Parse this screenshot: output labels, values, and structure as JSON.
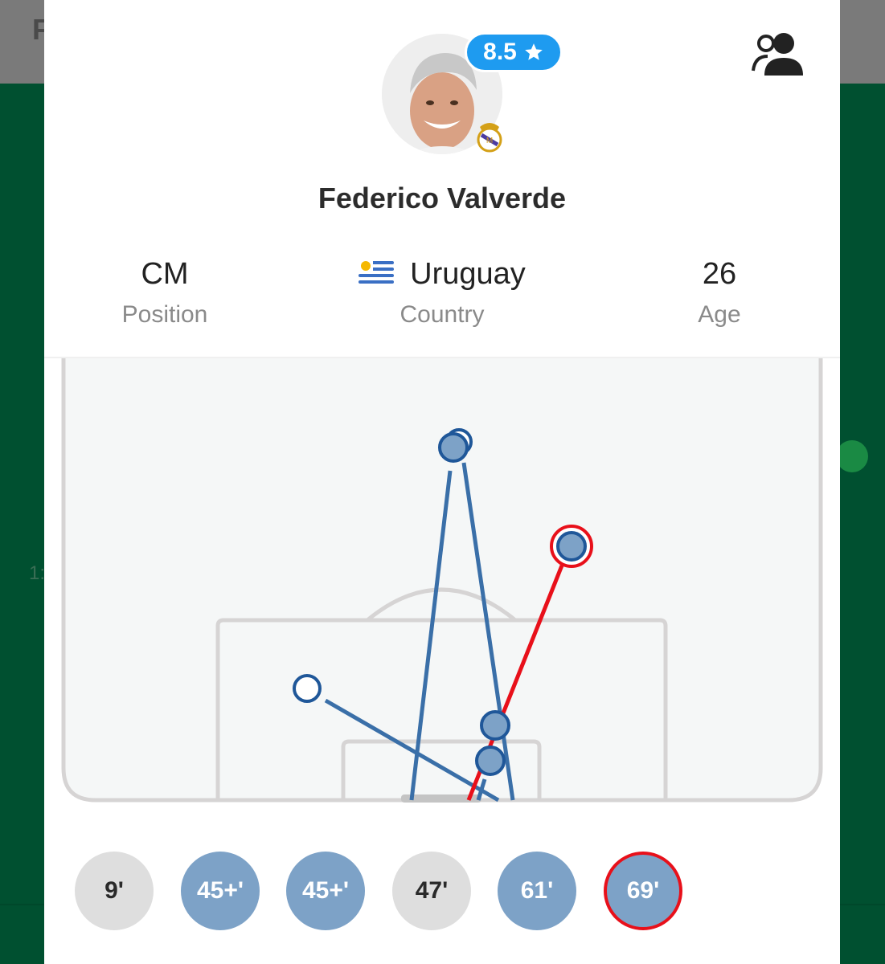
{
  "background": {
    "header_letter": "F",
    "side_number": "1:"
  },
  "player": {
    "name": "Federico Valverde",
    "rating": "8.5",
    "rating_icon": "star-icon",
    "club_icon": "real-madrid-crest-icon"
  },
  "stats": {
    "position": {
      "value": "CM",
      "label": "Position"
    },
    "country": {
      "value": "Uruguay",
      "label": "Country",
      "flag_icon": "uruguay-flag-icon"
    },
    "age": {
      "value": "26",
      "label": "Age"
    }
  },
  "shot_minutes": [
    {
      "label": "9'",
      "style": "grey"
    },
    {
      "label": "45+'",
      "style": "blue"
    },
    {
      "label": "45+'",
      "style": "blue"
    },
    {
      "label": "47'",
      "style": "grey"
    },
    {
      "label": "61'",
      "style": "blue"
    },
    {
      "label": "69'",
      "style": "active"
    }
  ],
  "colors": {
    "rating_badge": "#1e9bf0",
    "shot_line": "#3a6fa8",
    "selected_shot": "#e8101a",
    "on_target_fill": "#7da2c7",
    "background_green": "#005030"
  }
}
